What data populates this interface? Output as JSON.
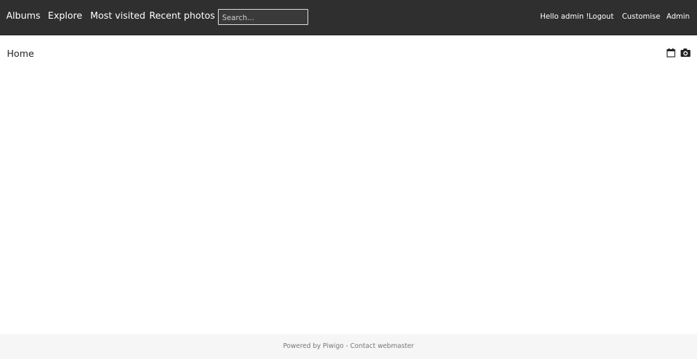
{
  "nav": {
    "items": [
      {
        "label": "Albums"
      },
      {
        "label": "Explore"
      },
      {
        "label": "Most visited"
      },
      {
        "label": "Recent photos"
      }
    ],
    "search": {
      "placeholder": "Search...",
      "value": ""
    }
  },
  "user": {
    "greeting": "Hello admin !",
    "logout": "Logout",
    "customise": "Customise",
    "admin": "Admin"
  },
  "main": {
    "title": "Home",
    "icons": [
      "calendar-icon",
      "camera-icon"
    ]
  },
  "footer": {
    "powered_by": "Powered by",
    "piwigo": "Piwigo",
    "separator": " - ",
    "contact": "Contact webmaster"
  },
  "colors": {
    "topbar": "#2f2f2f",
    "footer_bg": "#f6f6f6",
    "text": "#222222"
  }
}
